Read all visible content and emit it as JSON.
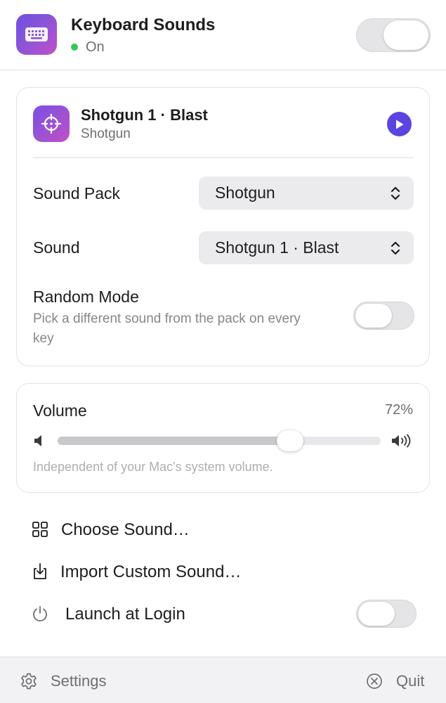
{
  "header": {
    "app_title": "Keyboard Sounds",
    "status_text": "On",
    "status_color": "#34c759",
    "icon": "keyboard-icon",
    "master_toggle_on": false
  },
  "now_playing": {
    "title": "Shotgun 1 · Blast",
    "subtitle": "Shotgun",
    "icon": "crosshair-icon",
    "play_icon": "play-icon",
    "accent_color": "#5a45e0"
  },
  "settings": {
    "sound_pack_label": "Sound Pack",
    "sound_pack_value": "Shotgun",
    "sound_label": "Sound",
    "sound_value": "Shotgun 1 · Blast",
    "random_mode_title": "Random Mode",
    "random_mode_desc": "Pick a different sound from the pack on every key",
    "random_mode_on": false
  },
  "volume": {
    "label": "Volume",
    "value_text": "72%",
    "level": 0.72,
    "note": "Independent of your Mac's system volume.",
    "low_icon": "speaker-low-icon",
    "high_icon": "speaker-high-icon"
  },
  "menu": {
    "choose_sound": "Choose Sound…",
    "import_custom": "Import Custom Sound…",
    "launch_at_login": "Launch at Login",
    "launch_at_login_on": false
  },
  "footer": {
    "settings_label": "Settings",
    "quit_label": "Quit"
  }
}
